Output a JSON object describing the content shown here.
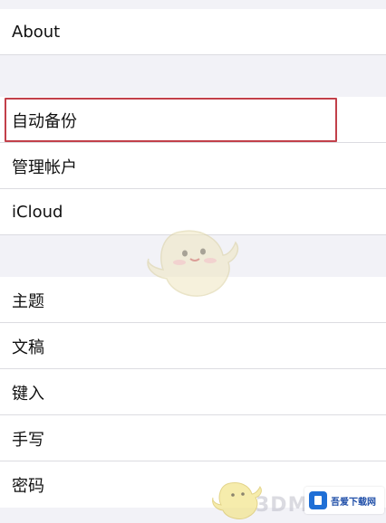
{
  "groups": {
    "top": {
      "items": [
        {
          "label": "About"
        }
      ]
    },
    "account": {
      "items": [
        {
          "label": "自动备份"
        },
        {
          "label": "管理帐户"
        },
        {
          "label": "iCloud"
        }
      ]
    },
    "settings": {
      "items": [
        {
          "label": "主题"
        },
        {
          "label": "文稿"
        },
        {
          "label": "键入"
        },
        {
          "label": "手写"
        },
        {
          "label": "密码"
        }
      ]
    }
  },
  "watermark": {
    "site_text": "3DM",
    "badge_text": "吾爱下载网",
    "mascot_icon": "bird-mascot-icon",
    "badge_icon": "download-badge-icon"
  },
  "colors": {
    "highlight_border": "#c2404a",
    "background": "#f2f2f7",
    "row_background": "#ffffff"
  }
}
